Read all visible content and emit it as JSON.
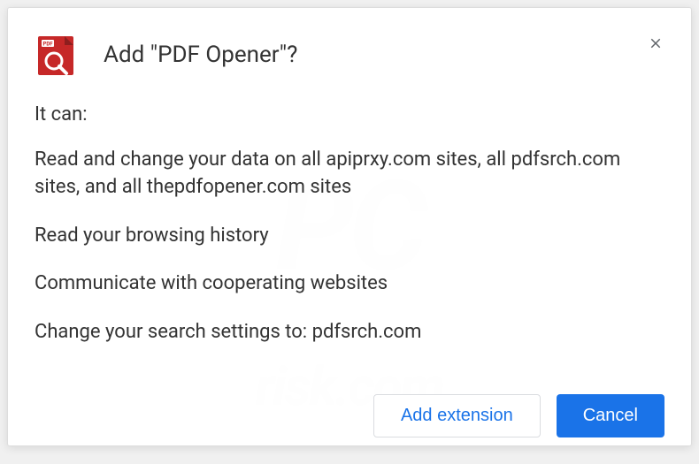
{
  "dialog": {
    "title": "Add \"PDF Opener\"?",
    "permission_intro": "It can:",
    "permissions": [
      "Read and change your data on all apiprxy.com sites, all pdfsrch.com sites, and all thepdfopener.com sites",
      "Read your browsing history",
      "Communicate with cooperating websites",
      "Change your search settings to: pdfsrch.com"
    ],
    "buttons": {
      "add": "Add extension",
      "cancel": "Cancel"
    },
    "icon_name": "pdf-opener-icon"
  },
  "watermark": {
    "main": "PC",
    "sub": "risk.com"
  }
}
